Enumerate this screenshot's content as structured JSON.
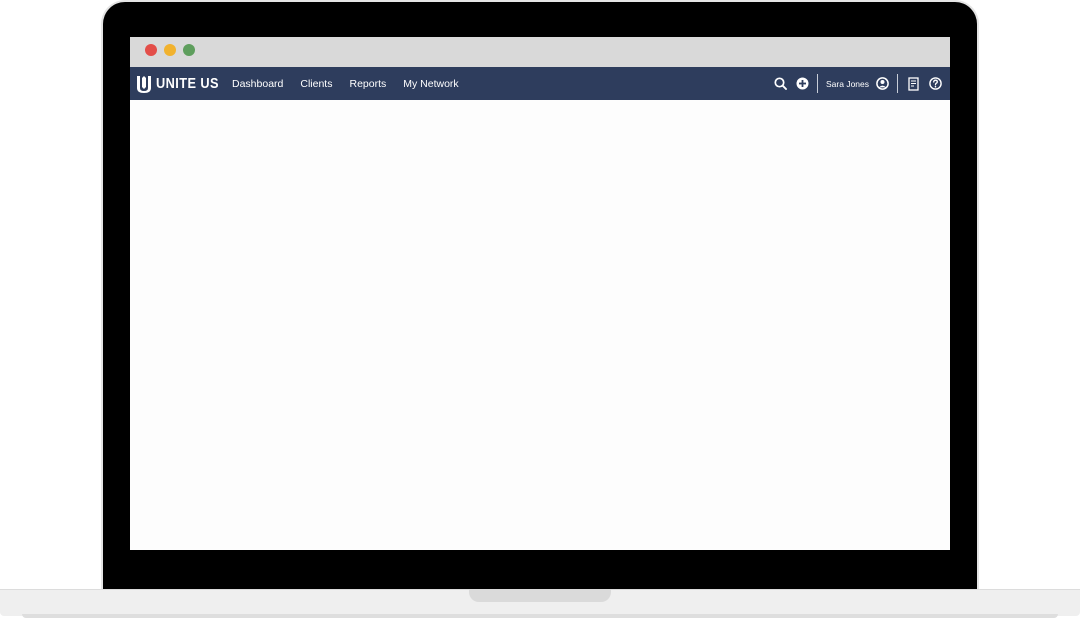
{
  "window": {
    "controls": {
      "close_color": "#e34e49",
      "minimize_color": "#f1b22e",
      "maximize_color": "#5e9e5d"
    }
  },
  "app": {
    "brand": "UNITE US",
    "nav_background": "#2e3d5d",
    "nav_items": [
      {
        "label": "Dashboard"
      },
      {
        "label": "Clients"
      },
      {
        "label": "Reports"
      },
      {
        "label": "My Network"
      }
    ],
    "user": {
      "name": "Sara Jones"
    },
    "icons": {
      "search": "search-icon",
      "add": "add-circle-icon",
      "user": "user-circle-icon",
      "document": "document-icon",
      "help": "help-circle-icon"
    }
  }
}
